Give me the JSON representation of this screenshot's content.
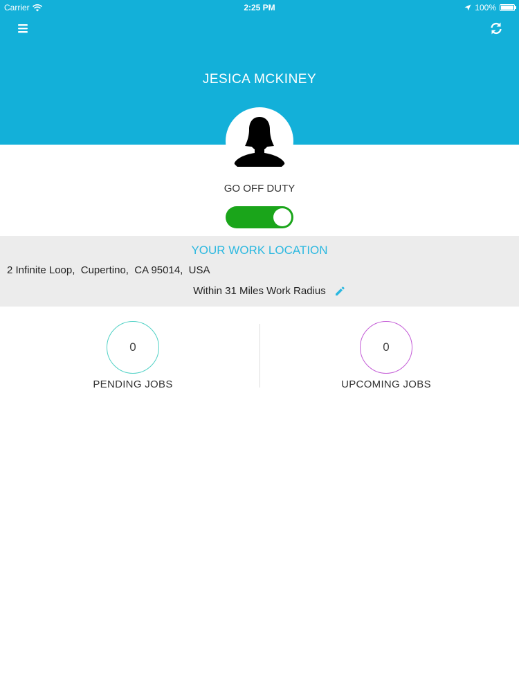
{
  "status_bar": {
    "carrier": "Carrier",
    "time": "2:25 PM",
    "battery": "100%",
    "battery_level": 1.0
  },
  "header": {
    "name": "JESICA MCKINEY",
    "menu_icon": "hamburger-menu-icon",
    "refresh_icon": "refresh-icon",
    "color": "#13b0d9"
  },
  "duty": {
    "label": "GO OFF DUTY",
    "toggle_on": true,
    "toggle_color": "#1aa51a"
  },
  "work_location": {
    "title": "YOUR WORK LOCATION",
    "address": "2 Infinite Loop,  Cupertino,  CA 95014,  USA",
    "radius": "Within 31 Miles Work Radius",
    "edit_icon": "pencil-icon"
  },
  "jobs": {
    "pending": {
      "count": "0",
      "label": "PENDING JOBS",
      "color": "#4fd1c5"
    },
    "upcoming": {
      "count": "0",
      "label": "UPCOMING JOBS",
      "color": "#c35ad6"
    }
  }
}
